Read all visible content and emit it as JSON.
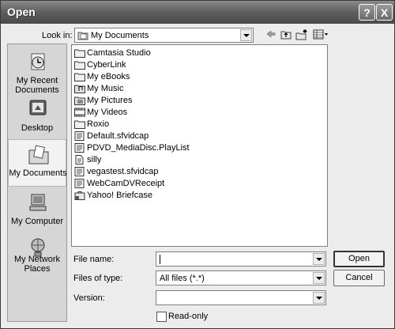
{
  "window": {
    "title": "Open",
    "help_glyph": "?",
    "close_glyph": "X"
  },
  "lookin": {
    "label": "Look in:",
    "value": "My Documents"
  },
  "places": [
    {
      "label": "My Recent Documents",
      "icon": "recent-documents-icon"
    },
    {
      "label": "Desktop",
      "icon": "desktop-icon"
    },
    {
      "label": "My Documents",
      "icon": "my-documents-icon"
    },
    {
      "label": "My Computer",
      "icon": "my-computer-icon"
    },
    {
      "label": "My Network Places",
      "icon": "network-places-icon"
    }
  ],
  "files": [
    {
      "name": "Camtasia Studio",
      "type": "folder"
    },
    {
      "name": "CyberLink",
      "type": "folder"
    },
    {
      "name": "My eBooks",
      "type": "folder"
    },
    {
      "name": "My Music",
      "type": "special-folder"
    },
    {
      "name": "My Pictures",
      "type": "special-folder"
    },
    {
      "name": "My Videos",
      "type": "special-folder"
    },
    {
      "name": "Roxio",
      "type": "folder"
    },
    {
      "name": "Default.sfvidcap",
      "type": "file"
    },
    {
      "name": "PDVD_MediaDisc.PlayList",
      "type": "file"
    },
    {
      "name": "silly",
      "type": "file"
    },
    {
      "name": "vegastest.sfvidcap",
      "type": "file"
    },
    {
      "name": "WebCamDVReceipt",
      "type": "file"
    },
    {
      "name": "Yahoo! Briefcase",
      "type": "briefcase"
    }
  ],
  "form": {
    "filename_label": "File name:",
    "filename_value": "",
    "filetype_label": "Files of type:",
    "filetype_value": "All files (*.*)",
    "version_label": "Version:",
    "version_value": "",
    "readonly_label": "Read-only"
  },
  "buttons": {
    "open": "Open",
    "cancel": "Cancel"
  }
}
